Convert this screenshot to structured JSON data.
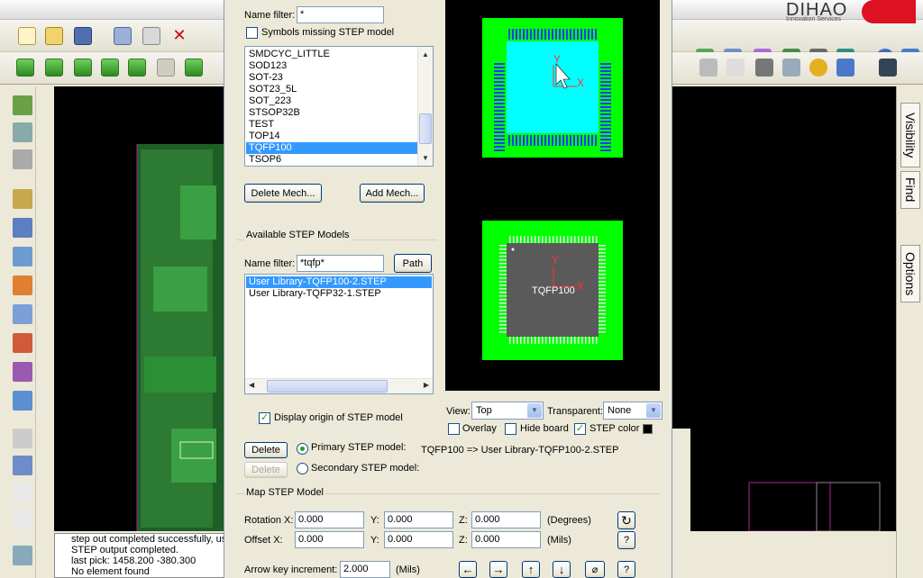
{
  "dialog": {
    "symbol_name_filter_label": "Name filter:",
    "symbol_name_filter_value": "*",
    "symbols_missing_label": "Symbols missing STEP model",
    "symbols": [
      "SMDCYC_LITTLE",
      "SOD123",
      "SOT-23",
      "SOT23_5L",
      "SOT_223",
      "STSOP32B",
      "TEST",
      "TOP14",
      "TQFP100",
      "TSOP6"
    ],
    "selected_symbol": "TQFP100",
    "delete_mech_label": "Delete Mech...",
    "add_mech_label": "Add Mech...",
    "available_models_title": "Available STEP Models",
    "model_name_filter_label": "Name filter:",
    "model_name_filter_value": "*tqfp*",
    "path_label": "Path",
    "models": [
      "User Library-TQFP100-2.STEP",
      "User Library-TQFP32-1.STEP"
    ],
    "display_origin_label": "Display origin of STEP model",
    "delete_label_1": "Delete",
    "delete_label_2": "Delete",
    "primary_model_label": "Primary STEP model:",
    "primary_mapping": "TQFP100 => User Library-TQFP100-2.STEP",
    "secondary_model_label": "Secondary STEP model:",
    "view_label": "View:",
    "view_value": "Top",
    "transparent_label": "Transparent:",
    "transparent_value": "None",
    "overlay_label": "Overlay",
    "hide_board_label": "Hide board",
    "step_color_label": "STEP color",
    "map_title": "Map STEP Model",
    "rotation_label": "Rotation X:",
    "offset_label": "Offset X:",
    "y_label": "Y:",
    "z_label": "Z:",
    "rotation": {
      "x": "0.000",
      "y": "0.000",
      "z": "0.000",
      "unit": "(Degrees)"
    },
    "offset": {
      "x": "0.000",
      "y": "0.000",
      "z": "0.000",
      "unit": "(Mils)"
    },
    "arrow_inc_label": "Arrow key increment:",
    "arrow_inc_value": "2.000",
    "arrow_inc_unit": "(Mils)",
    "help_label": "?",
    "preview_chip_label": "TQFP100",
    "axis_x": "X",
    "axis_y": "Y"
  },
  "log": {
    "lines": [
      "step out completed successfully, us",
      "STEP output completed.",
      "last pick:  1458.200 -380.300",
      "No element found"
    ]
  },
  "right_tabs": [
    "Visibility",
    "Find",
    "Options"
  ],
  "brand": {
    "name": "DIHAO",
    "sub": "Innovation Services"
  },
  "colors": {
    "selection": "#3399ff",
    "pcb_green": "#00ff00",
    "chip_cyan": "#00ffff",
    "canvas": "#000000"
  }
}
